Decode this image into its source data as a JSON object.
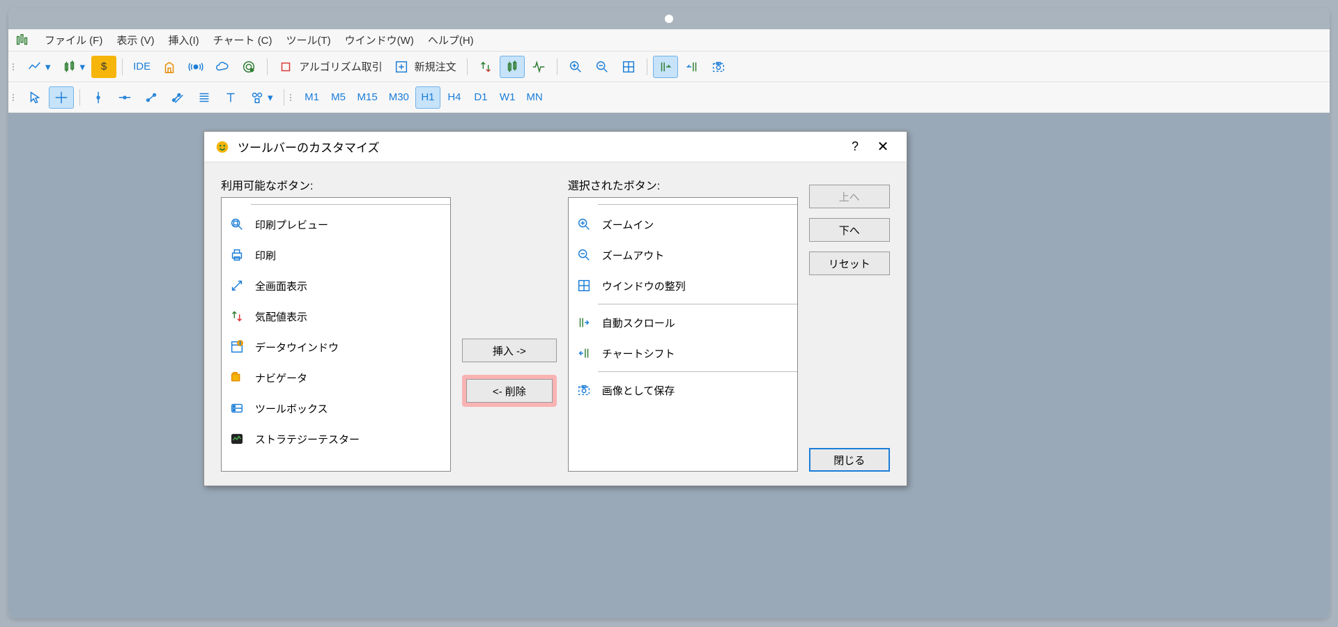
{
  "menu": {
    "file": "ファイル (F)",
    "view": "表示 (V)",
    "insert": "挿入(I)",
    "chart": "チャート (C)",
    "tools": "ツール(T)",
    "window": "ウインドウ(W)",
    "help": "ヘルプ(H)"
  },
  "toolbar1": {
    "ide": "IDE",
    "algo": "アルゴリズム取引",
    "neworder": "新規注文"
  },
  "toolbar2": {
    "tf": [
      "M1",
      "M5",
      "M15",
      "M30",
      "H1",
      "H4",
      "D1",
      "W1",
      "MN"
    ],
    "active": "H1"
  },
  "dialog": {
    "title": "ツールバーのカスタマイズ",
    "available_label": "利用可能なボタン:",
    "selected_label": "選択されたボタン:",
    "insert_btn": "挿入 ->",
    "remove_btn": "<- 削除",
    "up_btn": "上へ",
    "down_btn": "下へ",
    "reset_btn": "リセット",
    "close_btn": "閉じる",
    "available_items": [
      {
        "icon": "print-preview",
        "label": "印刷プレビュー"
      },
      {
        "icon": "print",
        "label": "印刷"
      },
      {
        "icon": "fullscreen",
        "label": "全画面表示"
      },
      {
        "icon": "market-watch",
        "label": "気配値表示"
      },
      {
        "icon": "data-window",
        "label": "データウインドウ"
      },
      {
        "icon": "navigator",
        "label": "ナビゲータ"
      },
      {
        "icon": "toolbox",
        "label": "ツールボックス"
      },
      {
        "icon": "tester",
        "label": "ストラテジーテスター"
      }
    ],
    "selected_items": [
      {
        "icon": "zoom-in",
        "label": "ズームイン"
      },
      {
        "icon": "zoom-out",
        "label": "ズームアウト"
      },
      {
        "icon": "tile",
        "label": "ウインドウの整列"
      },
      {
        "type": "sep"
      },
      {
        "icon": "autoscroll",
        "label": "自動スクロール"
      },
      {
        "icon": "chartshift",
        "label": "チャートシフト"
      },
      {
        "type": "sep"
      },
      {
        "icon": "camera",
        "label": "画像として保存"
      }
    ]
  }
}
